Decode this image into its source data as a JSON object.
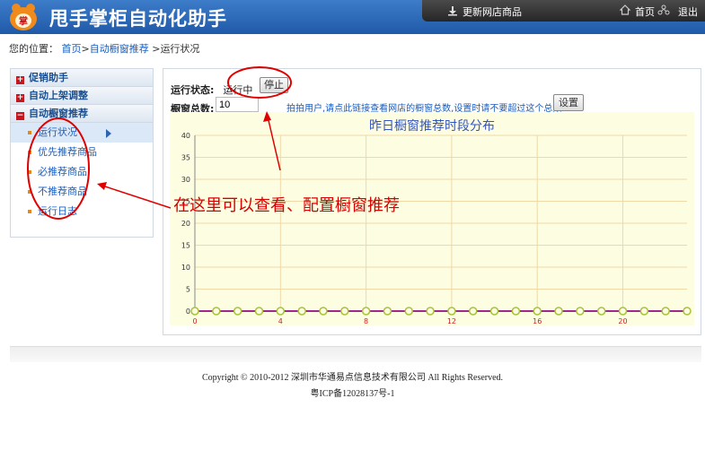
{
  "header": {
    "app_title": "甩手掌柜自动化助手",
    "logo_char": "掌",
    "refresh_label": "更新网店商品",
    "home_label": "首页",
    "exit_label": "退出"
  },
  "breadcrumb": {
    "prefix": "您的位置：",
    "home": "首页",
    "sep1": ">",
    "section": "自动橱窗推荐",
    "sep2": " >",
    "current": "运行状况"
  },
  "sidebar": {
    "groups": [
      {
        "label": "促销助手",
        "expanded": false
      },
      {
        "label": "自动上架调整",
        "expanded": false
      },
      {
        "label": "自动橱窗推荐",
        "expanded": true
      }
    ],
    "items": [
      {
        "label": "运行状况",
        "active": true
      },
      {
        "label": "优先推荐商品"
      },
      {
        "label": "必推荐商品"
      },
      {
        "label": "不推荐商品"
      },
      {
        "label": "运行日志"
      }
    ]
  },
  "status": {
    "label": "运行状态:",
    "value": "运行中",
    "stop_button": "停止"
  },
  "window_count": {
    "label": "橱窗总数:",
    "value": "10",
    "hint": "拍拍用户,请点此链接查看网店的橱窗总数,设置时请不要超过这个总数",
    "set_button": "设置"
  },
  "annotation": {
    "text": "在这里可以查看、配置橱窗推荐",
    "color": "#d60000"
  },
  "chart_data": {
    "type": "line",
    "title": "昨日橱窗推荐时段分布",
    "x": [
      0,
      1,
      2,
      3,
      4,
      5,
      6,
      7,
      8,
      9,
      10,
      11,
      12,
      13,
      14,
      15,
      16,
      17,
      18,
      19,
      20,
      21,
      22,
      23
    ],
    "x_tick_labels": [
      "0",
      "4",
      "8",
      "12",
      "16",
      "20"
    ],
    "y_tick_labels": [
      "0",
      "5",
      "10",
      "15",
      "20",
      "25",
      "30",
      "35",
      "40"
    ],
    "values": [
      0,
      0,
      0,
      0,
      0,
      0,
      0,
      0,
      0,
      0,
      0,
      0,
      0,
      0,
      0,
      0,
      0,
      0,
      0,
      0,
      0,
      0,
      0,
      0
    ],
    "ylim": [
      0,
      40
    ],
    "xlim": [
      0,
      23
    ],
    "grid": true,
    "line_color": "#a0288c",
    "marker_color": "#a6c23a",
    "background": "#fdfde2"
  },
  "footer": {
    "copyright": "Copyright © 2010-2012 深圳市华通易点信息技术有限公司   All Rights Reserved.",
    "icp": "粤ICP备12028137号-1"
  }
}
